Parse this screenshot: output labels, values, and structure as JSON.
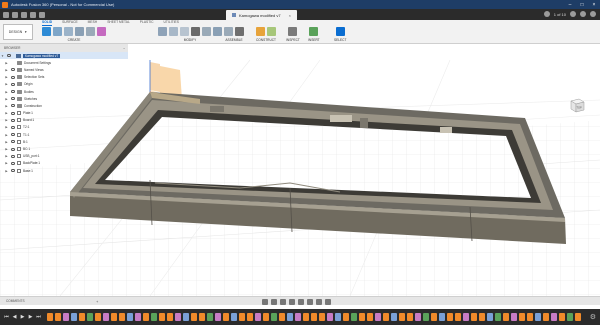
{
  "window": {
    "title": "Autodesk Fusion 360 (Personal - Not for Commercial Use)"
  },
  "doc_tab": {
    "label": "Kamogawa modified v7",
    "close": "×"
  },
  "appbar": {
    "right_text": "1 of 10"
  },
  "toolbar": {
    "workspace": "DESIGN",
    "tabs": [
      "SOLID",
      "SURFACE",
      "MESH",
      "SHEET METAL",
      "PLASTIC",
      "UTILITIES"
    ],
    "groups": [
      "CREATE",
      "MODIFY",
      "ASSEMBLE",
      "CONSTRUCT",
      "INSPECT",
      "INSERT",
      "SELECT"
    ],
    "colors": {
      "accent": "#0a6dd1",
      "create": "#2e8bd6",
      "modify": "#8fa3b8",
      "assemble": "#6f6f6f",
      "construct": "#e7a33a",
      "inspect": "#7a7a7a",
      "insert": "#5aa25a",
      "select": "#0a6dd1"
    }
  },
  "browser": {
    "header": "BROWSER",
    "root": "Kamogawa modified v7",
    "items": [
      {
        "label": "Document Settings",
        "kind": "folder-gear"
      },
      {
        "label": "Named Views",
        "kind": "folder"
      },
      {
        "label": "Selection Sets",
        "kind": "folder"
      },
      {
        "label": "Origin",
        "kind": "folder"
      },
      {
        "label": "Bodies",
        "kind": "folder"
      },
      {
        "label": "Sketches",
        "kind": "folder"
      },
      {
        "label": "Construction",
        "kind": "folder"
      },
      {
        "label": "Plate:1",
        "kind": "component"
      },
      {
        "label": "Board:1",
        "kind": "component"
      },
      {
        "label": "T2:1",
        "kind": "component"
      },
      {
        "label": "T1:1",
        "kind": "component"
      },
      {
        "label": "B:1",
        "kind": "component"
      },
      {
        "label": "BC:1",
        "kind": "component"
      },
      {
        "label": "USB_port:1",
        "kind": "component"
      },
      {
        "label": "BackPlate:1",
        "kind": "component"
      },
      {
        "label": "Base:1",
        "kind": "component"
      }
    ]
  },
  "comments": {
    "label": "COMMENTS",
    "plus": "+"
  },
  "viewcube": {
    "face": "TOP"
  },
  "timeline": {
    "controls": [
      "⏮",
      "◀",
      "▶",
      "▶",
      "⏭"
    ],
    "step_colors": [
      "#f08a2a",
      "#f08a2a",
      "#c77cc4",
      "#7aa0d6",
      "#f08a2a",
      "#5aa25a",
      "#f08a2a",
      "#c77cc4",
      "#f08a2a",
      "#f08a2a",
      "#7aa0d6",
      "#c77cc4",
      "#f08a2a",
      "#5aa25a",
      "#f08a2a",
      "#f08a2a",
      "#c77cc4",
      "#7aa0d6",
      "#f08a2a",
      "#f08a2a",
      "#5aa25a",
      "#c77cc4",
      "#f08a2a",
      "#7aa0d6",
      "#f08a2a",
      "#f08a2a",
      "#c77cc4",
      "#f08a2a",
      "#5aa25a",
      "#f08a2a",
      "#7aa0d6",
      "#c77cc4",
      "#f08a2a",
      "#f08a2a",
      "#f08a2a",
      "#c77cc4",
      "#7aa0d6",
      "#f08a2a",
      "#5aa25a",
      "#f08a2a",
      "#f08a2a",
      "#c77cc4",
      "#f08a2a",
      "#7aa0d6",
      "#f08a2a",
      "#f08a2a",
      "#c77cc4",
      "#5aa25a",
      "#f08a2a",
      "#7aa0d6",
      "#f08a2a",
      "#f08a2a",
      "#c77cc4",
      "#f08a2a",
      "#f08a2a",
      "#7aa0d6",
      "#5aa25a",
      "#f08a2a",
      "#c77cc4",
      "#f08a2a",
      "#f08a2a",
      "#7aa0d6",
      "#f08a2a",
      "#c77cc4",
      "#f08a2a",
      "#5aa25a",
      "#f08a2a"
    ]
  }
}
